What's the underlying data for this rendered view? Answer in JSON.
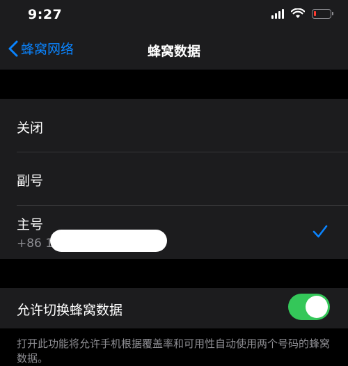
{
  "status_bar": {
    "time": "9:27",
    "battery_level": 0.15,
    "battery_color": "#ff3b30"
  },
  "nav": {
    "back_label": "蜂窝网络",
    "title": "蜂窝数据"
  },
  "options": [
    {
      "label": "关闭",
      "selected": false
    },
    {
      "label": "副号",
      "selected": false
    },
    {
      "label": "主号",
      "sublabel": "+86 1",
      "selected": true
    }
  ],
  "switch_row": {
    "label": "允许切换蜂窝数据",
    "enabled": true,
    "on_color": "#34c759"
  },
  "footer": {
    "text": "打开此功能将允许手机根据覆盖率和可用性自动使用两个号码的蜂窝数据。"
  },
  "colors": {
    "accent": "#0a84ff",
    "background": "#000000",
    "cell": "#1c1c1e"
  }
}
